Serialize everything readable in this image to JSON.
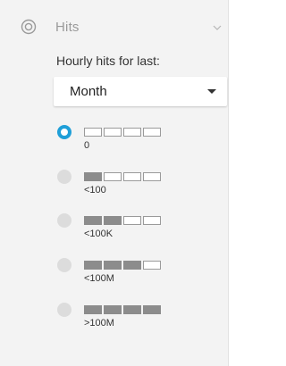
{
  "header": {
    "title": "Hits",
    "icon": "target-icon",
    "toggle_icon": "chevron-down-icon"
  },
  "period": {
    "label": "Hourly hits for last:",
    "selected": "Month"
  },
  "options": [
    {
      "label": "0",
      "level": 0,
      "selected": true
    },
    {
      "label": "<100",
      "level": 1,
      "selected": false
    },
    {
      "label": "<100K",
      "level": 2,
      "selected": false
    },
    {
      "label": "<100M",
      "level": 3,
      "selected": false
    },
    {
      "label": ">100M",
      "level": 4,
      "selected": false
    }
  ],
  "colors": {
    "accent": "#1f9fd8",
    "panel_bg": "#f3f3f3",
    "bar_filled": "#8c8c8c"
  }
}
